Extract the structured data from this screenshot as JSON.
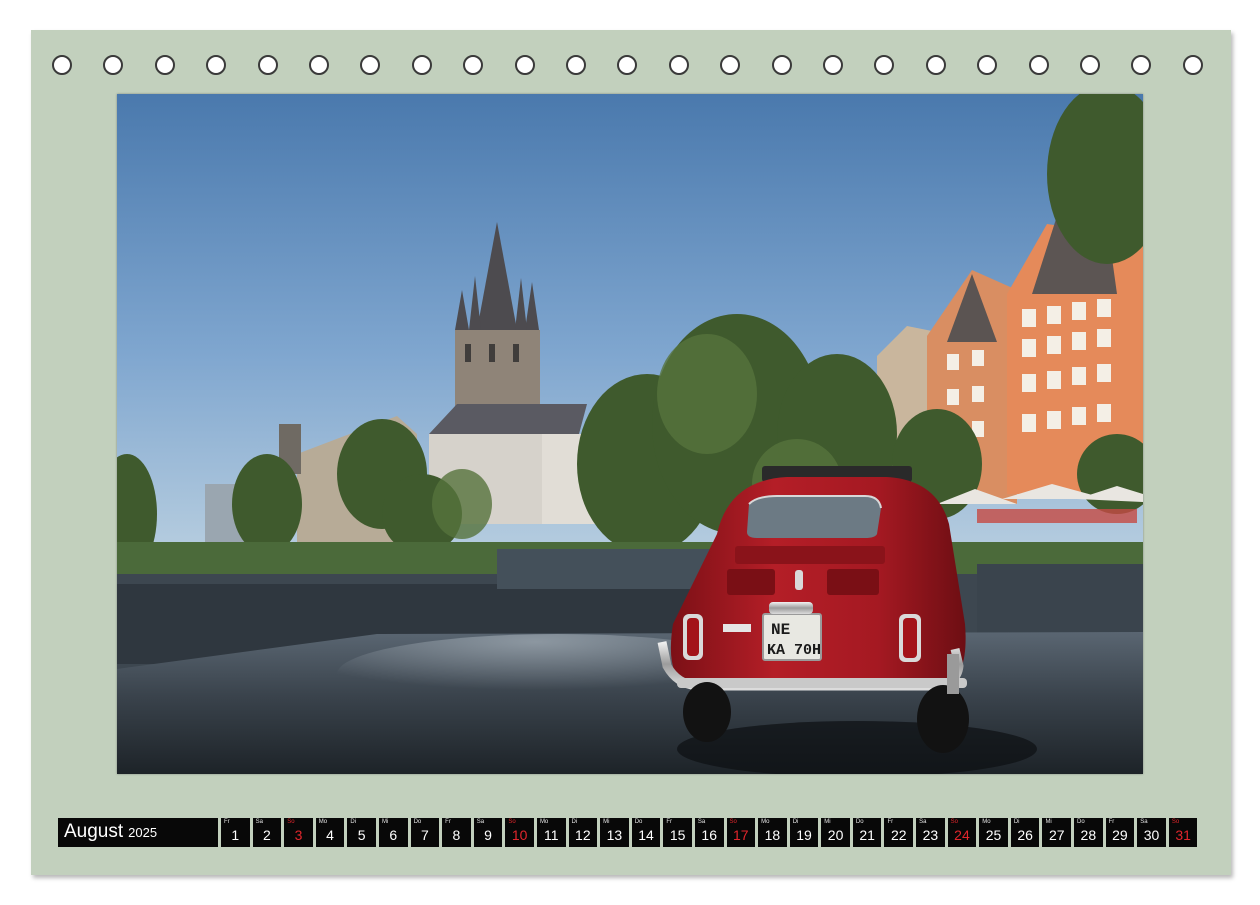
{
  "calendar": {
    "month": "August",
    "year": "2025",
    "days": [
      {
        "wd": "Fr",
        "n": "1"
      },
      {
        "wd": "Sa",
        "n": "2"
      },
      {
        "wd": "So",
        "n": "3",
        "sun": true
      },
      {
        "wd": "Mo",
        "n": "4"
      },
      {
        "wd": "Di",
        "n": "5"
      },
      {
        "wd": "Mi",
        "n": "6"
      },
      {
        "wd": "Do",
        "n": "7"
      },
      {
        "wd": "Fr",
        "n": "8"
      },
      {
        "wd": "Sa",
        "n": "9"
      },
      {
        "wd": "So",
        "n": "10",
        "sun": true
      },
      {
        "wd": "Mo",
        "n": "11"
      },
      {
        "wd": "Di",
        "n": "12"
      },
      {
        "wd": "Mi",
        "n": "13"
      },
      {
        "wd": "Do",
        "n": "14"
      },
      {
        "wd": "Fr",
        "n": "15"
      },
      {
        "wd": "Sa",
        "n": "16"
      },
      {
        "wd": "So",
        "n": "17",
        "sun": true
      },
      {
        "wd": "Mo",
        "n": "18"
      },
      {
        "wd": "Di",
        "n": "19"
      },
      {
        "wd": "Mi",
        "n": "20"
      },
      {
        "wd": "Do",
        "n": "21"
      },
      {
        "wd": "Fr",
        "n": "22"
      },
      {
        "wd": "Sa",
        "n": "23"
      },
      {
        "wd": "So",
        "n": "24",
        "sun": true
      },
      {
        "wd": "Mo",
        "n": "25"
      },
      {
        "wd": "Di",
        "n": "26"
      },
      {
        "wd": "Mi",
        "n": "27"
      },
      {
        "wd": "Do",
        "n": "28"
      },
      {
        "wd": "Fr",
        "n": "29"
      },
      {
        "wd": "Sa",
        "n": "30"
      },
      {
        "wd": "So",
        "n": "31",
        "sun": true
      }
    ]
  },
  "photo": {
    "plate_line1": "NE",
    "plate_line2": "KA 70H"
  },
  "colors": {
    "frame": "#c2d0bd",
    "strip": "#080808",
    "sunday": "#e2262c",
    "car": "#b01c24"
  }
}
